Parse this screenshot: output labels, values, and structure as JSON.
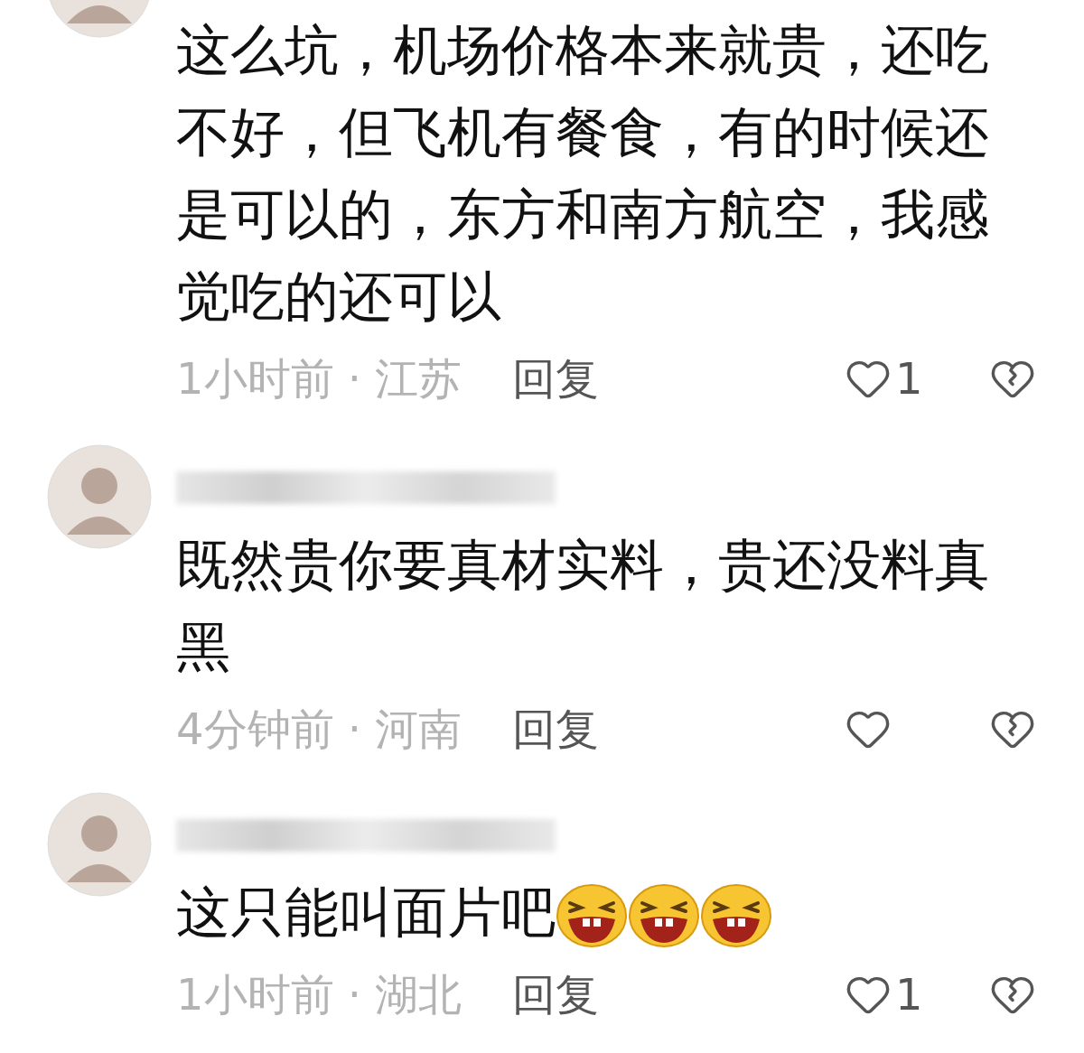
{
  "comments": [
    {
      "username_blurred": false,
      "text": "这么坑，机场价格本来就贵，还吃不好，但飞机有餐食，有的时候还是可以的，东方和南方航空，我感觉吃的还可以",
      "meta": "1小时前 · 江苏",
      "reply": "回复",
      "like_count": "1"
    },
    {
      "username_blurred": true,
      "text": "既然贵你要真材实料，贵还没料真黑",
      "meta": "4分钟前 · 河南",
      "reply": "回复"
    },
    {
      "username_blurred": true,
      "text": "这只能叫面片吧",
      "emojis": [
        {
          "kind": "laughing"
        },
        {
          "kind": "laughing"
        },
        {
          "kind": "laughing"
        }
      ],
      "meta": "1小时前 · 湖北",
      "reply": "回复",
      "like_count": "1"
    }
  ]
}
